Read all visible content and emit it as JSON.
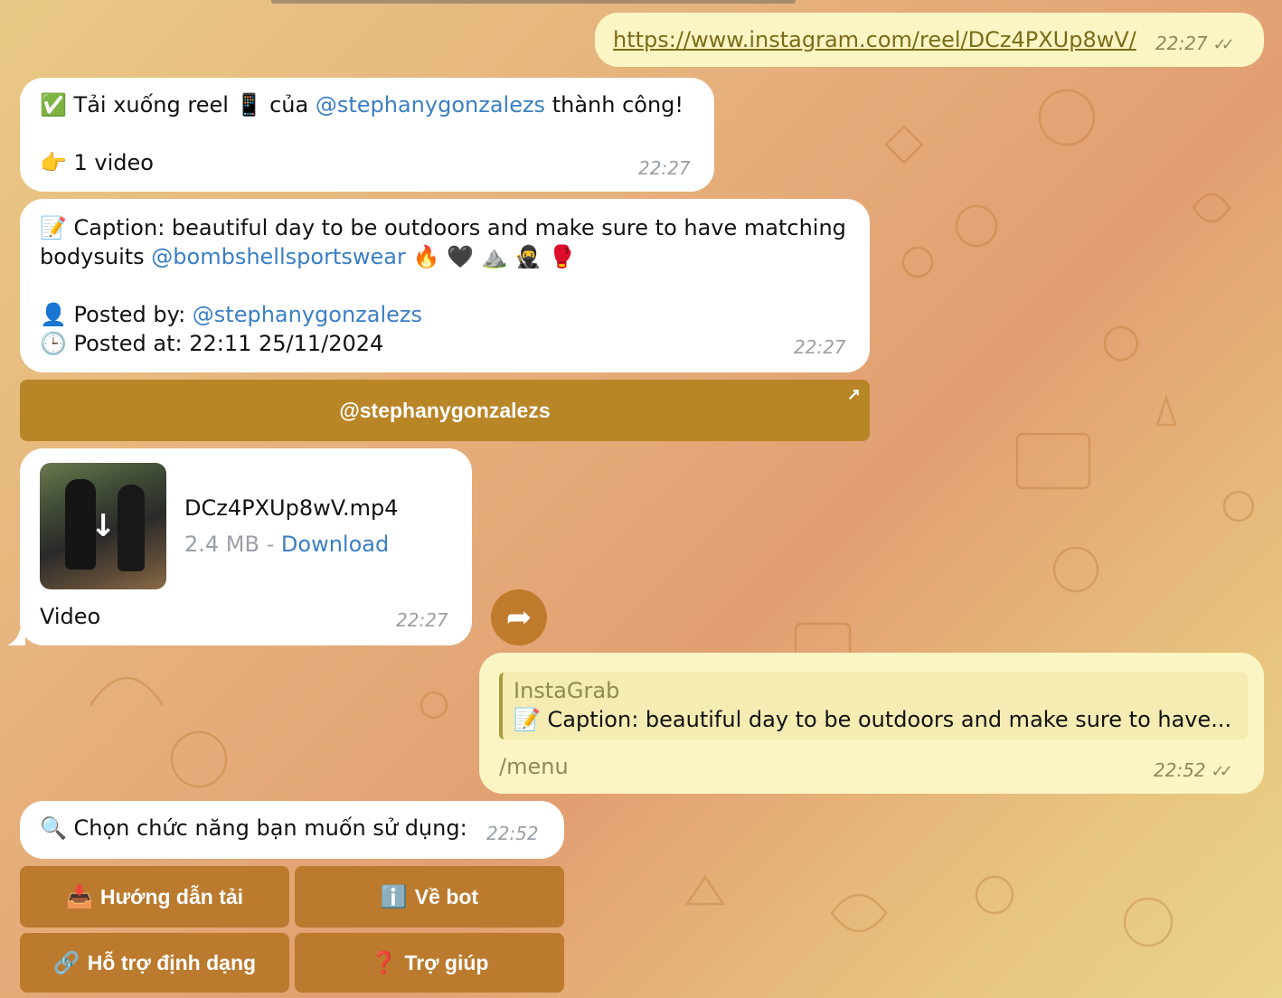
{
  "messages": {
    "link_msg": {
      "text": "https://www.instagram.com/reel/DCz4PXUp8wV/",
      "time": "22:27"
    },
    "success_msg": {
      "line1_a": "Tải xuống reel",
      "line1_b": "của",
      "line1_user": "@stephanygonzalezs",
      "line1_c": "thành công!",
      "line2": "1 video",
      "time": "22:27"
    },
    "caption_msg": {
      "line1": "Caption: beautiful day to be outdoors and make sure to have matching",
      "line2_a": "bodysuits",
      "line2_user": "@bombshellsportswear",
      "posted_by_label": "Posted by:",
      "posted_by_user": "@stephanygonzalezs",
      "posted_at": "Posted at: 22:11 25/11/2024",
      "time": "22:27"
    },
    "profile_button": {
      "label": "@stephanygonzalezs"
    },
    "file_msg": {
      "filename": "DCz4PXUp8wV.mp4",
      "size": "2.4 MB",
      "separator": "-",
      "download": "Download",
      "label": "Video",
      "time": "22:27"
    },
    "reply_msg": {
      "reply_name": "InstaGrab",
      "reply_text": "Caption: beautiful day to be outdoors and make sure to have...",
      "text": "/menu",
      "time": "22:52"
    },
    "menu_msg": {
      "text": "Chọn chức năng bạn muốn sử dụng:",
      "time": "22:52"
    }
  },
  "keyboard": {
    "btn1": "Hướng dẫn tải",
    "btn2": "Về bot",
    "btn3": "Hỗ trợ định dạng",
    "btn4": "Trợ giúp"
  },
  "icons": {
    "check": "✅",
    "phone": "📱",
    "point": "👉",
    "memo": "📝",
    "fire": "🔥",
    "heart": "🖤",
    "mountain": "⛰️",
    "ninja": "🥷",
    "glove": "🥊",
    "user": "👤",
    "clock": "🕒",
    "search": "🔍",
    "inbox": "📥",
    "info": "ℹ️",
    "link": "🔗",
    "question": "❓"
  },
  "colors": {
    "link": "#3a7fc4",
    "button": "#bb7a2d",
    "outgoing": "#fbf5c4",
    "incoming": "#ffffff"
  }
}
